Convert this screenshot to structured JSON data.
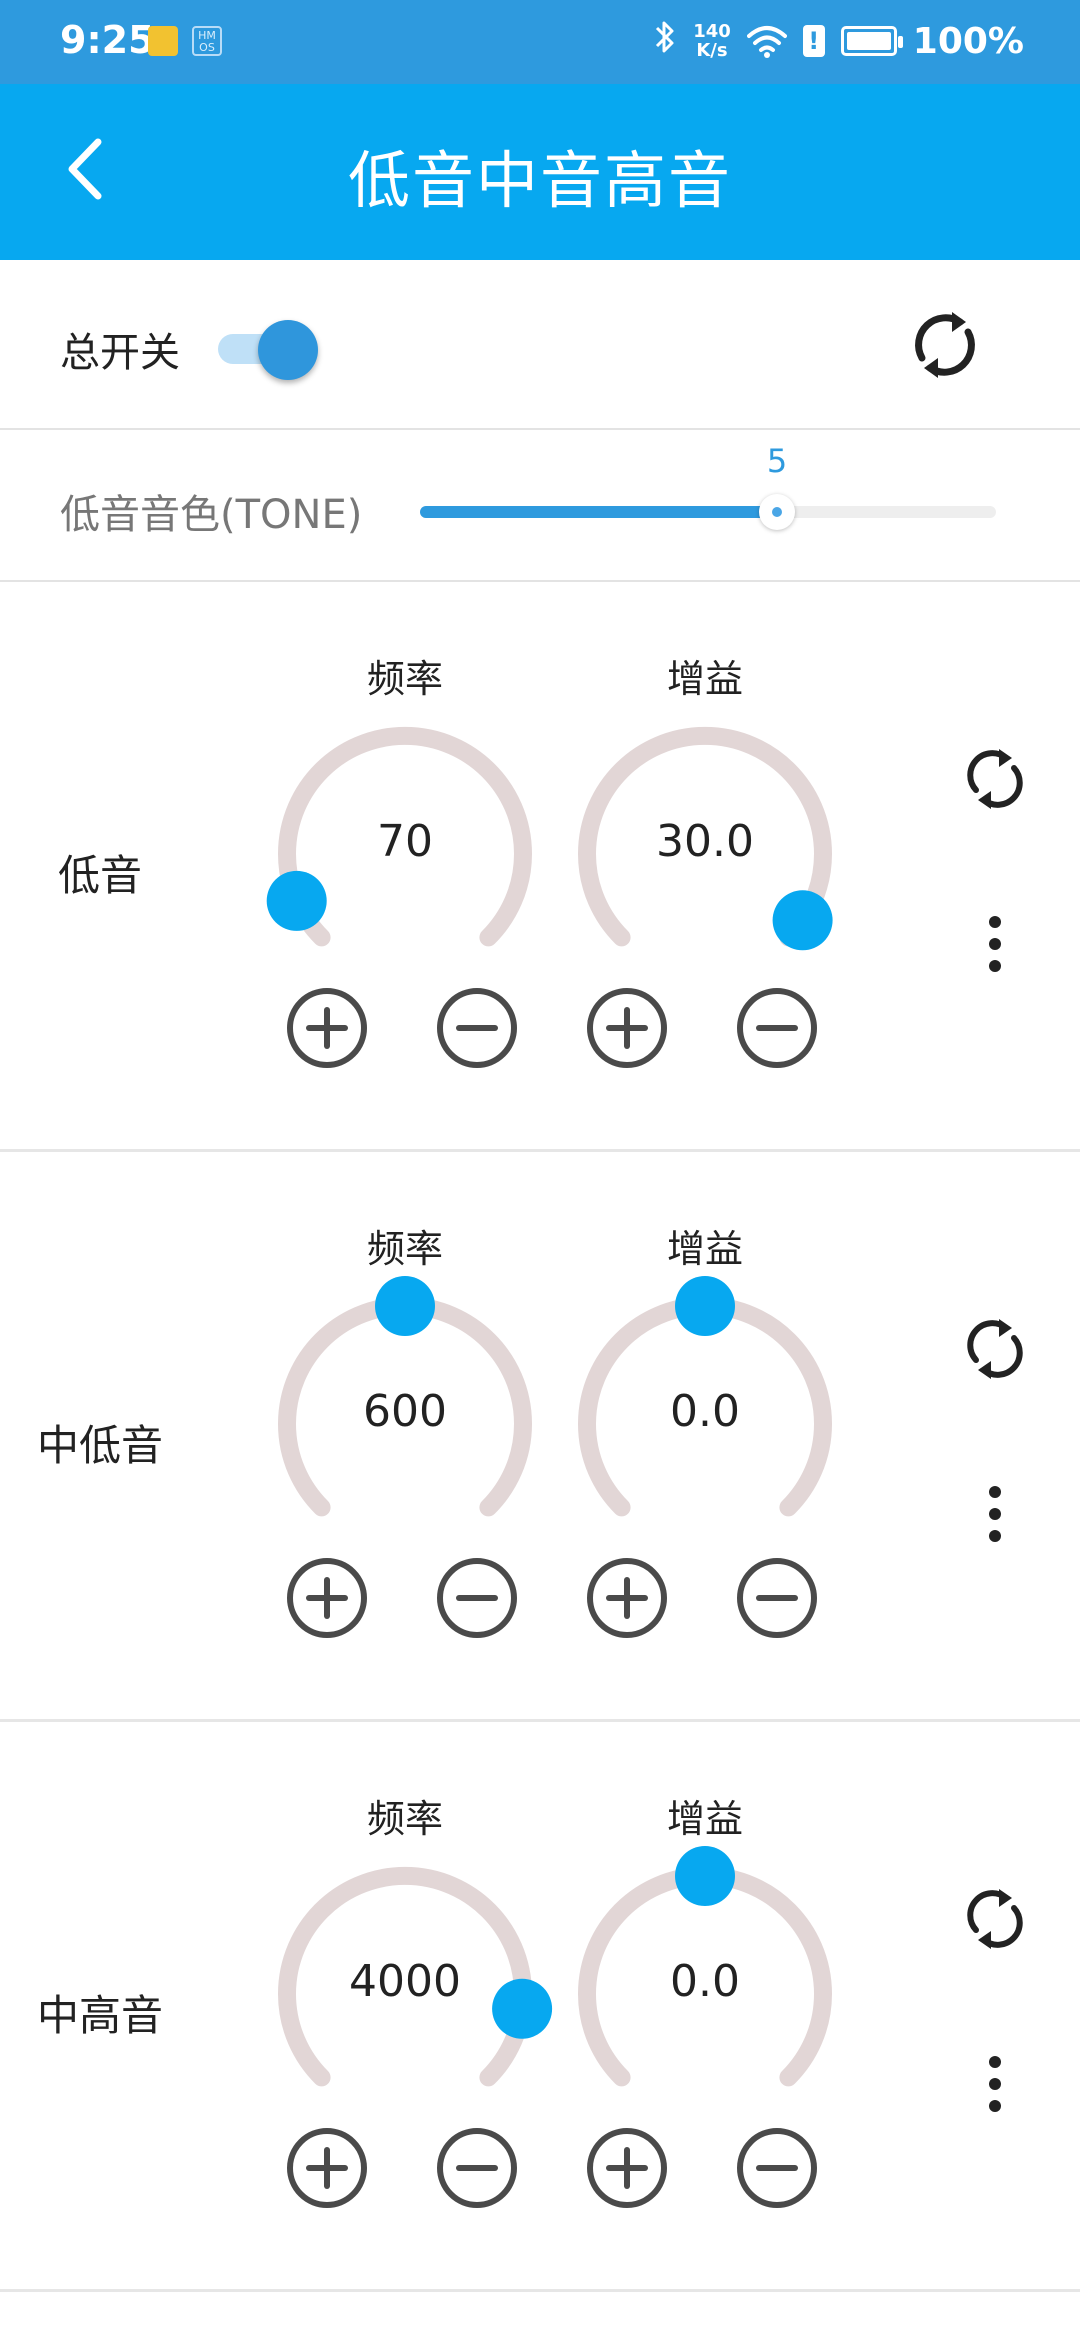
{
  "status_bar": {
    "time": "9:25",
    "hm_badge": "HM\nOS",
    "speed_top": "140",
    "speed_bottom": "K/s",
    "battery": "100%",
    "alert": "!"
  },
  "app_bar": {
    "title": "低音中音高音",
    "back_icon": "chevron-left-icon"
  },
  "master": {
    "label": "总开关",
    "toggle_on": true,
    "reset_icon": "refresh-icon"
  },
  "tone": {
    "label": "低音音色(TONE)",
    "value": "5",
    "fraction": 0.62
  },
  "colors": {
    "status_bar": "#2e9ade",
    "app_bar": "#07a8f0",
    "accent": "#07a8f0",
    "knob_track": "#e2d6d6",
    "button_stroke": "#4a4a4a"
  },
  "bands": [
    {
      "label": "低音",
      "freq": {
        "title": "频率",
        "value": "70",
        "fraction": 0.08
      },
      "gain": {
        "title": "增益",
        "value": "30.0",
        "fraction": 0.96
      }
    },
    {
      "label": "中低音",
      "freq": {
        "title": "频率",
        "value": "600",
        "fraction": 0.5
      },
      "gain": {
        "title": "增益",
        "value": "0.0",
        "fraction": 0.5
      }
    },
    {
      "label": "中高音",
      "freq": {
        "title": "频率",
        "value": "4000",
        "fraction": 0.86
      },
      "gain": {
        "title": "增益",
        "value": "0.0",
        "fraction": 0.5
      }
    }
  ]
}
